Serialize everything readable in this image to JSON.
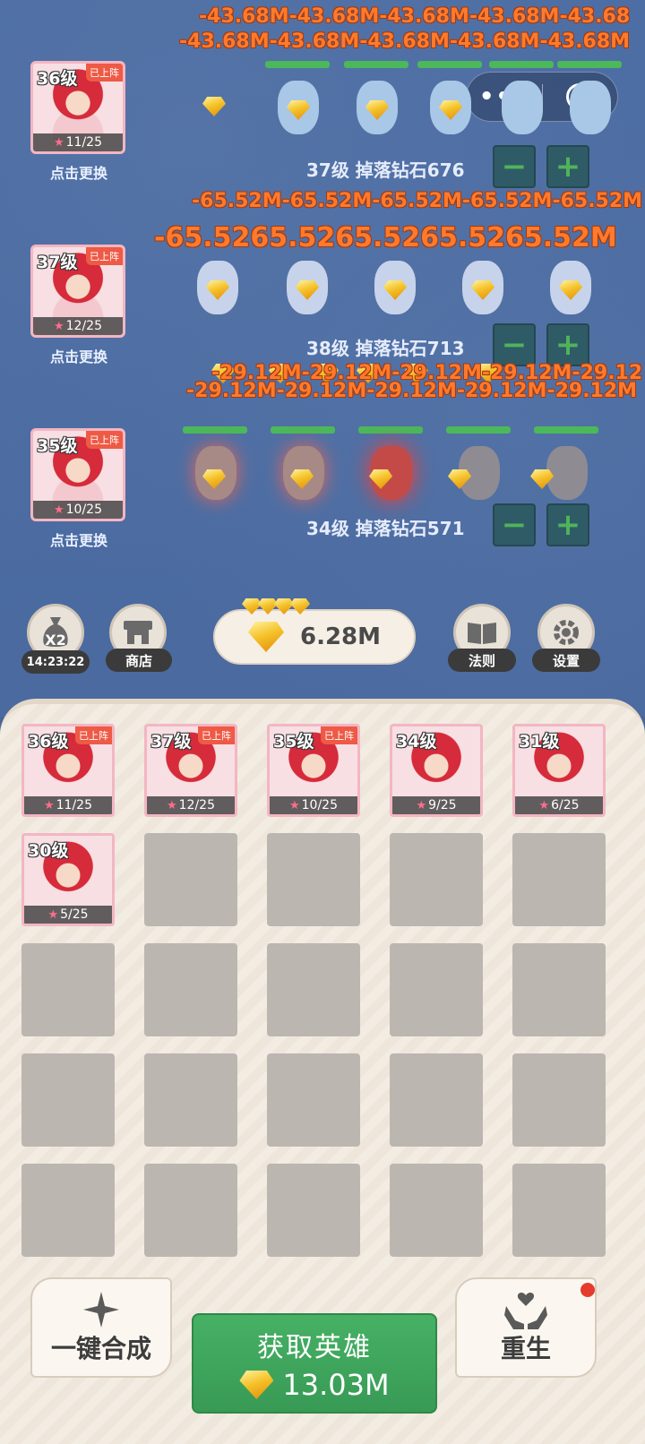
{
  "damage": {
    "lane1_row1": "-43.68M-43.68M-43.68M-43.68M-43.68",
    "lane1_row2": "-43.68M-43.68M-43.68M-43.68M-43.68M",
    "lane2_row1": "-65.52M-65.52M-65.52M-65.52M-65.52M",
    "lane2_row2": "-65.5265.5265.5265.5265.52M",
    "lane3_row1": "-29.12M-29.12M-29.12M-29.12M-29.12",
    "lane3_row2": "-29.12M-29.12M-29.12M-29.12M-29.12M"
  },
  "lanes": [
    {
      "hero_level": "36级",
      "deployed": "已上阵",
      "stars": "11/25",
      "replace": "点击更换",
      "drop_label": "37级  掉落钻石676",
      "minus": "−",
      "plus": "+"
    },
    {
      "hero_level": "37级",
      "deployed": "已上阵",
      "stars": "12/25",
      "replace": "点击更换",
      "drop_label": "38级  掉落钻石713",
      "minus": "−",
      "plus": "+"
    },
    {
      "hero_level": "35级",
      "deployed": "已上阵",
      "stars": "10/25",
      "replace": "点击更换",
      "drop_label": "34级  掉落钻石571",
      "minus": "−",
      "plus": "+"
    }
  ],
  "capsule": {
    "more": "•••"
  },
  "toolbar": {
    "boost_badge": "X2",
    "timer": "14:23:22",
    "shop": "商店",
    "gem_total": "6.28M",
    "rules": "法则",
    "settings": "设置"
  },
  "inventory": [
    {
      "level": "36级",
      "deployed": "已上阵",
      "stars": "11/25"
    },
    {
      "level": "37级",
      "deployed": "已上阵",
      "stars": "12/25"
    },
    {
      "level": "35级",
      "deployed": "已上阵",
      "stars": "10/25"
    },
    {
      "level": "34级",
      "deployed": "",
      "stars": "9/25"
    },
    {
      "level": "31级",
      "deployed": "",
      "stars": "6/25"
    },
    {
      "level": "30级",
      "deployed": "",
      "stars": "5/25"
    }
  ],
  "actions": {
    "merge_all": "一键合成",
    "recruit_title": "获取英雄",
    "recruit_cost": "13.03M",
    "rebirth": "重生"
  },
  "colors": {
    "battlefield": "#46669a",
    "damage_text": "#ff7a2c",
    "hp_bar": "#4bb85a",
    "recruit_green": "#389a55",
    "control_button": "#2f5b66"
  }
}
